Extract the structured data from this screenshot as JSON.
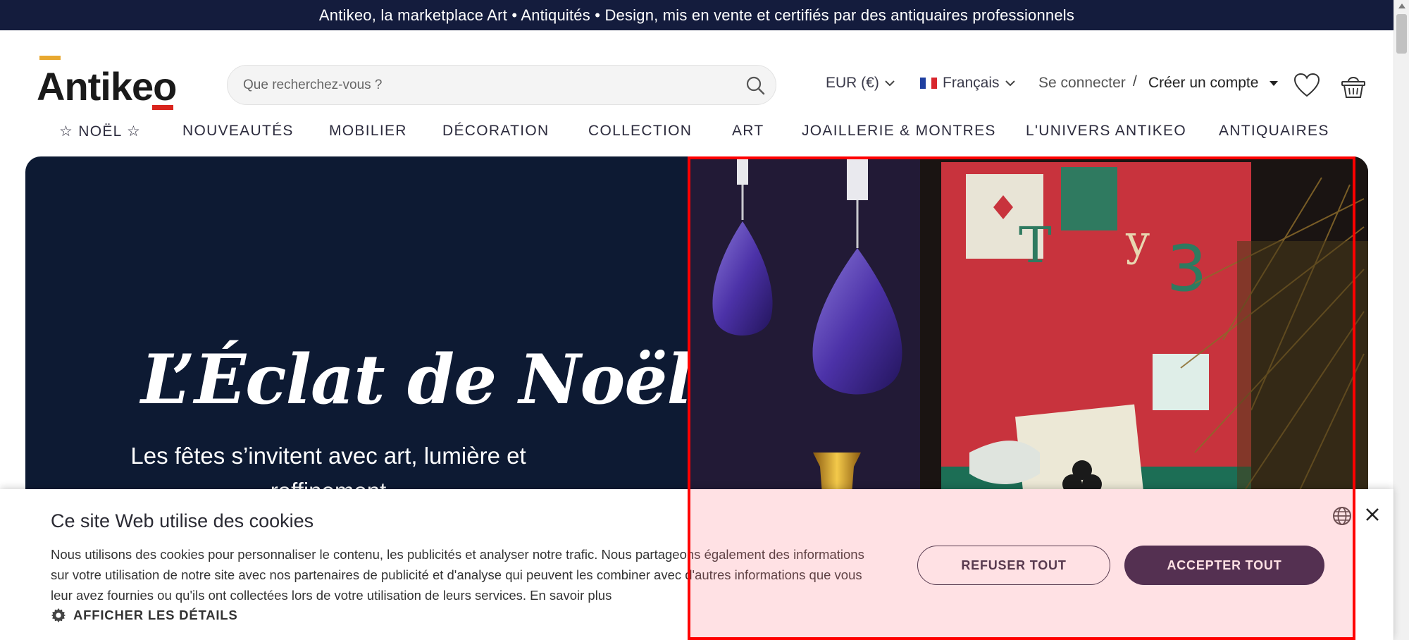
{
  "announcement": "Antikeo, la marketplace Art • Antiquités • Design, mis en vente et certifiés par des antiquaires professionnels",
  "logo": {
    "text": "Antikeo"
  },
  "search": {
    "placeholder": "Que recherchez-vous ?",
    "icon": "search-icon"
  },
  "header": {
    "currency": "EUR (€)",
    "language": "Français",
    "login": "Se connecter",
    "separator": "/",
    "signup": "Créer un compte"
  },
  "nav": {
    "items": [
      "☆ NOËL ☆",
      "NOUVEAUTÉS",
      "MOBILIER",
      "DÉCORATION",
      "COLLECTION",
      "ART",
      "JOAILLERIE & MONTRES",
      "L'UNIVERS ANTIKEO",
      "ANTIQUAIRES"
    ]
  },
  "hero": {
    "title": "L’Éclat de Noël",
    "subtitle": "Les fêtes s’invitent avec art, lumière et raffinement"
  },
  "cookie": {
    "title": "Ce site Web utilise des cookies",
    "text": "Nous utilisons des cookies pour personnaliser le contenu, les publicités et analyser notre trafic. Nous partageons également des informations sur votre utilisation de notre site avec nos partenaires de publicité et d'analyse qui peuvent les combiner avec d'autres informations que vous leur avez fournies ou qu'ils ont collectées lors de votre utilisation de leurs services.",
    "link": "En savoir plus",
    "details": "AFFICHER LES DÉTAILS",
    "refuse": "REFUSER TOUT",
    "accept": "ACCEPTER TOUT"
  },
  "colors": {
    "topbar": "#141c3d",
    "hero_bg": "#0d1a33",
    "accept_button": "#241d43",
    "highlight": "#ff0000",
    "logo_accent_top": "#e8a830",
    "logo_accent_bottom": "#d9241d"
  }
}
